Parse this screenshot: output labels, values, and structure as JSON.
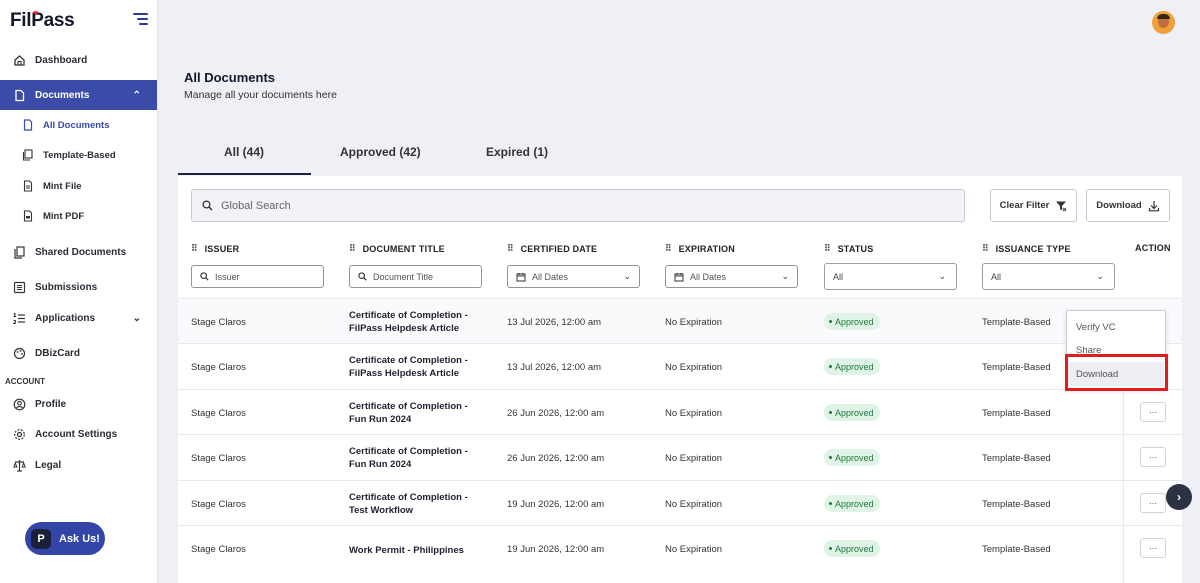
{
  "brand": {
    "name": "FilPass",
    "accent": "#3a4ba8",
    "heart_color": "#e02a3c"
  },
  "sidebar": {
    "items": [
      {
        "label": "Dashboard",
        "icon": "home-icon"
      },
      {
        "label": "Documents",
        "icon": "document-icon",
        "active": true,
        "expanded": true
      },
      {
        "label": "Shared Documents",
        "icon": "shared-documents-icon"
      },
      {
        "label": "Submissions",
        "icon": "submissions-icon"
      },
      {
        "label": "Applications",
        "icon": "applications-icon"
      },
      {
        "label": "DBizCard",
        "icon": "palette-icon"
      }
    ],
    "subitems": [
      {
        "label": "All Documents",
        "icon": "document-icon",
        "current": true
      },
      {
        "label": "Template-Based",
        "icon": "template-icon"
      },
      {
        "label": "Mint File",
        "icon": "file-icon"
      },
      {
        "label": "Mint PDF",
        "icon": "pdf-icon"
      }
    ],
    "account_label": "ACCOUNT",
    "account_items": [
      {
        "label": "Profile",
        "icon": "user-circle-icon"
      },
      {
        "label": "Account Settings",
        "icon": "gear-icon"
      },
      {
        "label": "Legal",
        "icon": "scale-icon"
      }
    ],
    "ask_us": "Ask Us!"
  },
  "header": {
    "title": "All Documents",
    "subtitle": "Manage all your documents here"
  },
  "tabs": [
    {
      "label": "All (44)",
      "active": true
    },
    {
      "label": "Approved (42)"
    },
    {
      "label": "Expired (1)"
    }
  ],
  "toolbar": {
    "search_placeholder": "Global Search",
    "clear_filter": "Clear Filter",
    "download": "Download"
  },
  "table": {
    "headers": {
      "issuer": "ISSUER",
      "title": "DOCUMENT TITLE",
      "certified": "CERTIFIED DATE",
      "expiration": "EXPIRATION",
      "status": "STATUS",
      "issuance": "ISSUANCE TYPE",
      "action": "ACTION"
    },
    "filters": {
      "issuer_placeholder": "Issuer",
      "title_placeholder": "Document Title",
      "certified_value": "All Dates",
      "expiration_value": "All Dates",
      "status_value": "All",
      "issuance_value": "All"
    },
    "rows": [
      {
        "issuer": "Stage Claros",
        "title1": "Certificate of Completion -",
        "title2": "FilPass Helpdesk Article",
        "certified": "13 Jul 2026, 12:00 am",
        "expiration": "No Expiration",
        "status": "Approved",
        "issuance": "Template-Based"
      },
      {
        "issuer": "Stage Claros",
        "title1": "Certificate of Completion -",
        "title2": "FilPass Helpdesk Article",
        "certified": "13 Jul 2026, 12:00 am",
        "expiration": "No Expiration",
        "status": "Approved",
        "issuance": "Template-Based"
      },
      {
        "issuer": "Stage Claros",
        "title1": "Certificate of Completion -",
        "title2": "Fun Run 2024",
        "certified": "26 Jun 2026, 12:00 am",
        "expiration": "No Expiration",
        "status": "Approved",
        "issuance": "Template-Based"
      },
      {
        "issuer": "Stage Claros",
        "title1": "Certificate of Completion -",
        "title2": "Fun Run 2024",
        "certified": "26 Jun 2026, 12:00 am",
        "expiration": "No Expiration",
        "status": "Approved",
        "issuance": "Template-Based"
      },
      {
        "issuer": "Stage Claros",
        "title1": "Certificate of Completion -",
        "title2": "Test Workflow",
        "certified": "19 Jun 2026, 12:00 am",
        "expiration": "No Expiration",
        "status": "Approved",
        "issuance": "Template-Based"
      },
      {
        "issuer": "Stage Claros",
        "title1": "Work Permit - Philippines",
        "title2": "",
        "certified": "19 Jun 2026, 12:00 am",
        "expiration": "No Expiration",
        "status": "Approved",
        "issuance": "Template-Based"
      }
    ]
  },
  "action_menu": {
    "items": [
      "Verify VC",
      "Share",
      "Download"
    ],
    "highlighted": "Download"
  },
  "more_label": "···"
}
